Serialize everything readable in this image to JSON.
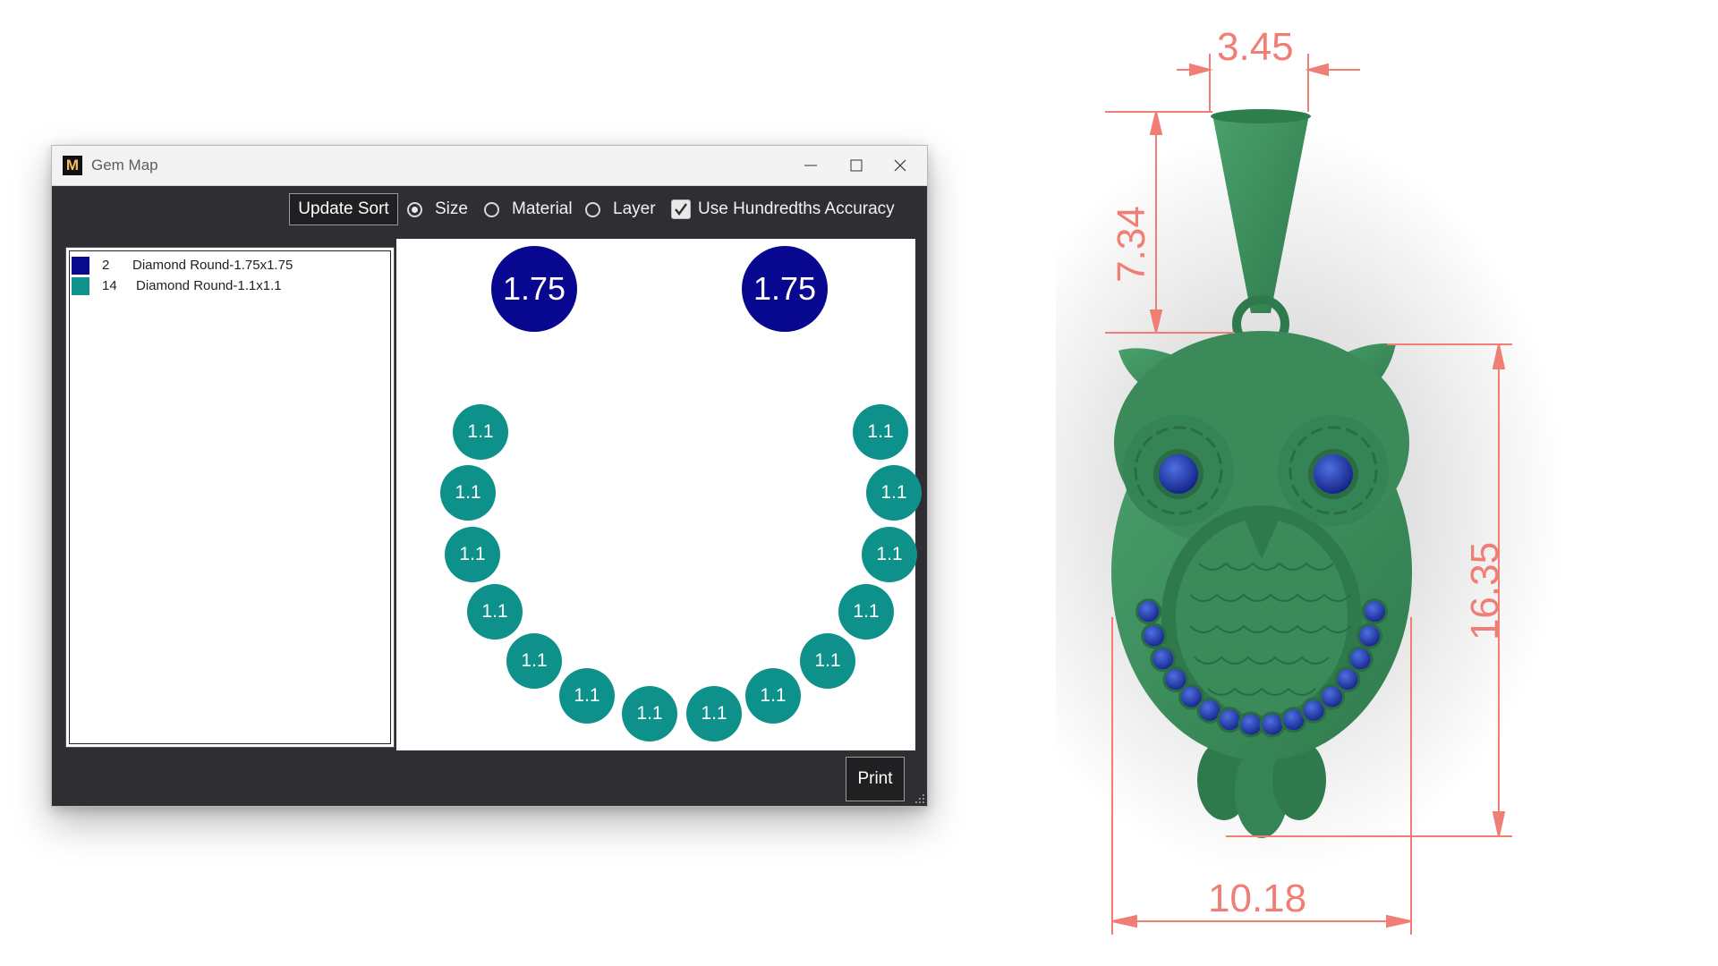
{
  "window": {
    "title": "Gem Map",
    "app_icon": "M",
    "controls": [
      "minimize-icon",
      "maximize-icon",
      "close-icon"
    ]
  },
  "toolbar": {
    "update_sort_label": "Update Sort",
    "sort_options": [
      {
        "label": "Size",
        "selected": true
      },
      {
        "label": "Material",
        "selected": false
      },
      {
        "label": "Layer",
        "selected": false
      }
    ],
    "hundredths_label": "Use Hundredths Accuracy",
    "hundredths_checked": true
  },
  "gem_list": [
    {
      "count": "2",
      "name": "Diamond Round-1.75x1.75",
      "color": "#0a0a8c"
    },
    {
      "count": "14",
      "name": "Diamond Round-1.1x1.1",
      "color": "#0f938c"
    }
  ],
  "gem_map": {
    "large_label": "1.75",
    "small_label": "1.1",
    "large_color": "#07078f",
    "small_color": "#0e918a"
  },
  "print_label": "Print",
  "dimensions": {
    "bail_width": "3.45",
    "bail_height": "7.34",
    "body_height": "16.35",
    "body_width": "10.18",
    "dimension_color": "#f07e74"
  },
  "pendant": {
    "metal_color": "#3a8a5a",
    "gem_color": "#1e3aa8"
  }
}
